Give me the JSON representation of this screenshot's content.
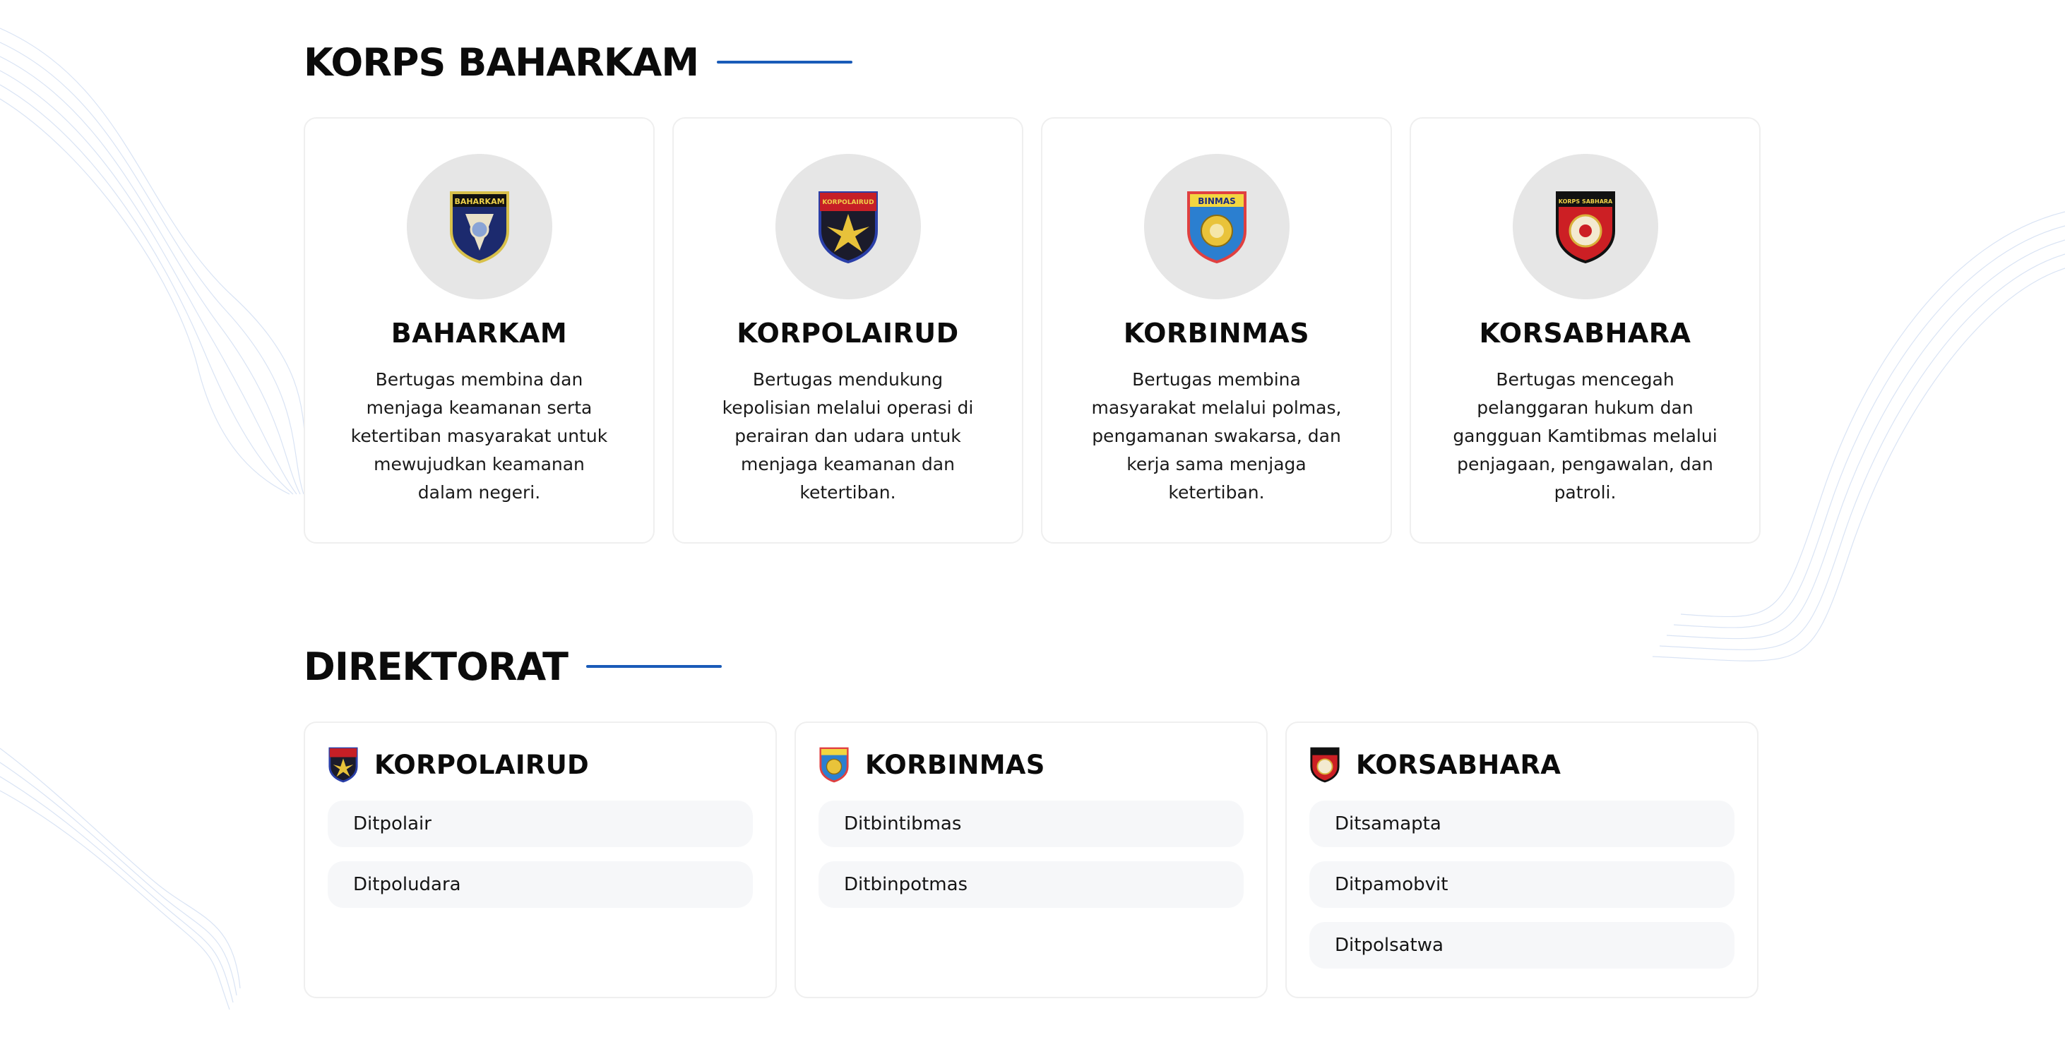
{
  "korps_section": {
    "title": "KORPS BAHARKAM",
    "cards": [
      {
        "name": "BAHARKAM",
        "emblem_text": "BAHARKAM",
        "description": "Bertugas membina dan menjaga keamanan serta ketertiban masyarakat untuk mewujudkan keamanan dalam negeri."
      },
      {
        "name": "KORPOLAIRUD",
        "emblem_text": "KORPOLAIRUD",
        "description": "Bertugas mendukung kepolisian melalui operasi di perairan dan udara untuk menjaga keamanan dan ketertiban."
      },
      {
        "name": "KORBINMAS",
        "emblem_text": "BINMAS",
        "description": "Bertugas membina masyarakat melalui polmas, pengamanan swakarsa, dan kerja sama menjaga ketertiban."
      },
      {
        "name": "KORSABHARA",
        "emblem_text": "KORPS SABHARA",
        "description": "Bertugas mencegah pelanggaran hukum dan gangguan Kamtibmas melalui penjagaan, pengawalan, dan patroli."
      }
    ]
  },
  "direktorat_section": {
    "title": "DIREKTORAT",
    "groups": [
      {
        "name": "KORPOLAIRUD",
        "items": [
          "Ditpolair",
          "Ditpoludara"
        ]
      },
      {
        "name": "KORBINMAS",
        "items": [
          "Ditbintibmas",
          "Ditbinpotmas"
        ]
      },
      {
        "name": "KORSABHARA",
        "items": [
          "Ditsamapta",
          "Ditpamobvit",
          "Ditpolsatwa"
        ]
      }
    ]
  },
  "colors": {
    "accent_line": "#1a5bb8",
    "emblem_circle": "#e6e6e6",
    "list_item_bg": "#f6f7f9"
  }
}
